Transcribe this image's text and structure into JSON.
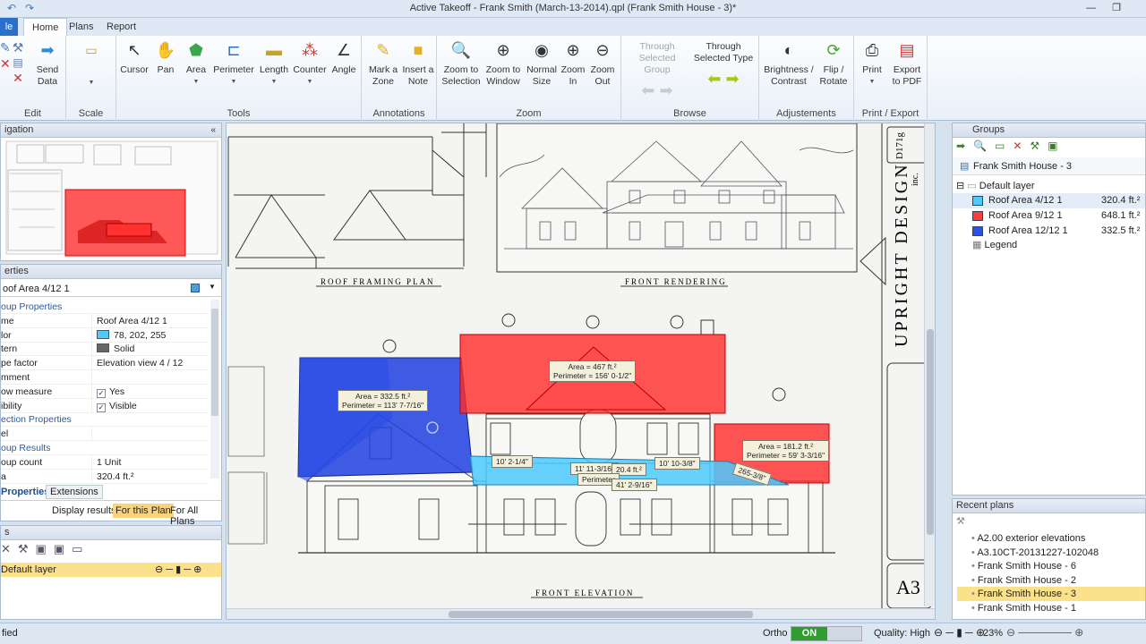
{
  "window": {
    "title": "Active Takeoff - Frank Smith (March-13-2014).qpl (Frank Smith House - 3)*"
  },
  "tabs": {
    "file": "le",
    "home": "Home",
    "plans": "Plans",
    "report": "Report"
  },
  "ribbon": {
    "edit": {
      "label": "Edit",
      "send": "Send Data"
    },
    "scale": {
      "label": "Scale"
    },
    "tools": {
      "label": "Tools",
      "cursor": "Cursor",
      "pan": "Pan",
      "area": "Area",
      "perimeter": "Perimeter",
      "length": "Length",
      "counter": "Counter",
      "angle": "Angle"
    },
    "annotations": {
      "label": "Annotations",
      "mark": "Mark a Zone",
      "note": "Insert a Note"
    },
    "zoom": {
      "label": "Zoom",
      "to_selection": "Zoom to Selection",
      "to_window": "Zoom to Window",
      "normal": "Normal Size",
      "in": "Zoom In",
      "out": "Zoom Out"
    },
    "browse": {
      "label": "Browse",
      "through_group": "Through Selected Group",
      "through_type": "Through Selected Type"
    },
    "adjust": {
      "label": "Adjustements",
      "brightness": "Brightness / Contrast",
      "flip": "Flip / Rotate"
    },
    "print": {
      "label": "Print / Export",
      "print": "Print",
      "export": "Export to PDF"
    }
  },
  "navigation": {
    "title": "igation"
  },
  "properties": {
    "title": "erties",
    "selected": "oof Area 4/12 1",
    "rows": [
      {
        "k": "oup Properties",
        "v": "",
        "cat": true
      },
      {
        "k": "me",
        "v": "Roof Area 4/12 1"
      },
      {
        "k": "lor",
        "v": "78, 202, 255",
        "swatch": "#4ecaff"
      },
      {
        "k": "tern",
        "v": "Solid",
        "swatch": "#666666"
      },
      {
        "k": "pe factor",
        "v": "Elevation view 4 / 12"
      },
      {
        "k": "mment",
        "v": ""
      },
      {
        "k": "ow measure",
        "v": "Yes",
        "check": true
      },
      {
        "k": "ibility",
        "v": "Visible",
        "check": true
      },
      {
        "k": "ection Properties",
        "v": "",
        "cat": true
      },
      {
        "k": "el",
        "v": ""
      },
      {
        "k": "oup Results",
        "v": "",
        "cat": true
      },
      {
        "k": "oup count",
        "v": "1 Unit"
      },
      {
        "k": "a",
        "v": "320.4 ft.²"
      }
    ],
    "tab_properties": "Properties",
    "tab_extensions": "Extensions",
    "display_results": "Display results:",
    "for_this_plan": "For this Plan",
    "for_all_plans": "For All Plans"
  },
  "layers": {
    "title": "s",
    "item": "Default layer"
  },
  "groups": {
    "title": "Groups",
    "plan": "Frank Smith House - 3",
    "layer": "Default layer",
    "items": [
      {
        "name": "Roof Area 4/12 1",
        "value": "320.4 ft.²",
        "color": "#4ecaff"
      },
      {
        "name": "Roof Area 9/12 1",
        "value": "648.1 ft.²",
        "color": "#ff3b3b"
      },
      {
        "name": "Roof Area 12/12 1",
        "value": "332.5 ft.²",
        "color": "#2f4fe0"
      }
    ],
    "legend": "Legend"
  },
  "recent": {
    "title": "Recent plans",
    "items": [
      "A2.00 exterior elevations",
      "A3.10CT-20131227-102048",
      "Frank Smith House - 6",
      "Frank Smith House - 2",
      "Frank Smith House - 3",
      "Frank Smith House - 1"
    ],
    "selected_index": 4
  },
  "drawing": {
    "roof_framing": "ROOF FRAMING PLAN",
    "front_rendering": "FRONT RENDERING",
    "front_elevation": "FRONT ELEVATION",
    "upright": "UPRIGHT DESIGN",
    "inc": "inc.",
    "sheet": "A3",
    "d171": "D171g",
    "m1_area": "Area = 332.5 ft.²",
    "m1_perim": "Perimeter = 113' 7-7/16\"",
    "m2_area": "Area = 467 ft.²",
    "m2_perim": "Perimeter = 156' 0-1/2\"",
    "m3_area": "Area = 181.2 ft.²",
    "m3_perim": "Perimeter = 59' 3-3/16\"",
    "l1": "10' 2-1/4\"",
    "l2": "11' 11-3/16\"",
    "l3": "20.4 ft.²",
    "l4": "10' 10-3/8\"",
    "l5": "Perimeter",
    "l6": "41' 2-9/16\"",
    "l7": "265-3/8\""
  },
  "status": {
    "left": "fied",
    "ortho": "Ortho",
    "on": "ON",
    "quality": "Quality: High",
    "zoom": "23%"
  }
}
